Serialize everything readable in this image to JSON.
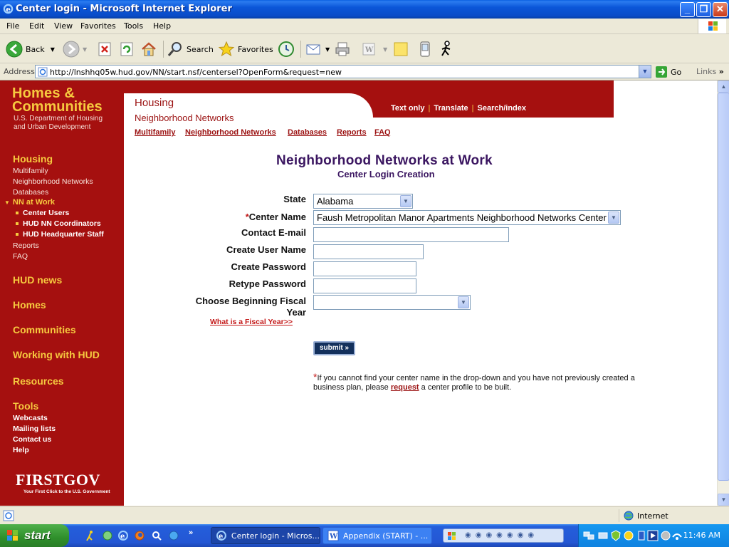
{
  "window": {
    "title": "Center login - Microsoft Internet Explorer"
  },
  "menu": [
    "File",
    "Edit",
    "View",
    "Favorites",
    "Tools",
    "Help"
  ],
  "toolbar": {
    "back": "Back",
    "search": "Search",
    "favorites": "Favorites"
  },
  "address": {
    "label": "Address",
    "url": "http://lnshhq05w.hud.gov/NN/start.nsf/centersel?OpenForm&request=new",
    "go": "Go",
    "links": "Links"
  },
  "hud": {
    "logo_line1": "Homes &",
    "logo_line2": "Communities",
    "logo_line3": "U.S. Department of Housing",
    "logo_line4": "and Urban Development",
    "section_title": "Housing",
    "section_sub": "Neighborhood Networks",
    "top_links": [
      "Text only",
      "Translate",
      "Search/index"
    ],
    "subnav": [
      "Multifamily",
      "Neighborhood Networks",
      "Databases",
      "Reports",
      "FAQ"
    ],
    "firstgov": "FIRSTGOV",
    "firstgov_tagline": "Your First Click to the U.S. Government"
  },
  "leftnav": {
    "housing": "Housing",
    "housing_links": [
      "Multifamily",
      "Neighborhood Networks",
      "Databases"
    ],
    "active": "NN at Work",
    "active_subs": [
      "Center Users",
      "HUD NN Coordinators",
      "HUD Headquarter Staff"
    ],
    "more_links": [
      "Reports",
      "FAQ"
    ],
    "sections": [
      "HUD news",
      "Homes",
      "Communities",
      "Working with HUD",
      "Resources",
      "Tools"
    ],
    "tools_links": [
      "Webcasts",
      "Mailing lists",
      "Contact us",
      "Help"
    ]
  },
  "form": {
    "title": "Neighborhood Networks at Work",
    "subtitle": "Center Login Creation",
    "state_label": "State",
    "state_value": "Alabama",
    "required_mark": "*",
    "center_label": "Center Name",
    "center_value": "Faush Metropolitan Manor Apartments Neighborhood Networks Center",
    "email_label": "Contact E-mail",
    "username_label": "Create User Name",
    "password_label": "Create Password",
    "retype_label": "Retype Password",
    "fiscal_label_1": "Choose Beginning Fiscal",
    "fiscal_label_2": "Year",
    "fiscal_link": "What is a Fiscal Year>>",
    "submit": "submit »",
    "note_before": "If you cannot find your center name in the drop-down and you have not previously created a business plan, please ",
    "note_link": "request",
    "note_after": " a center profile to be built."
  },
  "status": {
    "zone": "Internet"
  },
  "taskbar": {
    "start": "start",
    "tasks": [
      "Center login - Micros...",
      "Appendix (START) - ..."
    ],
    "clock": "11:46 AM"
  }
}
